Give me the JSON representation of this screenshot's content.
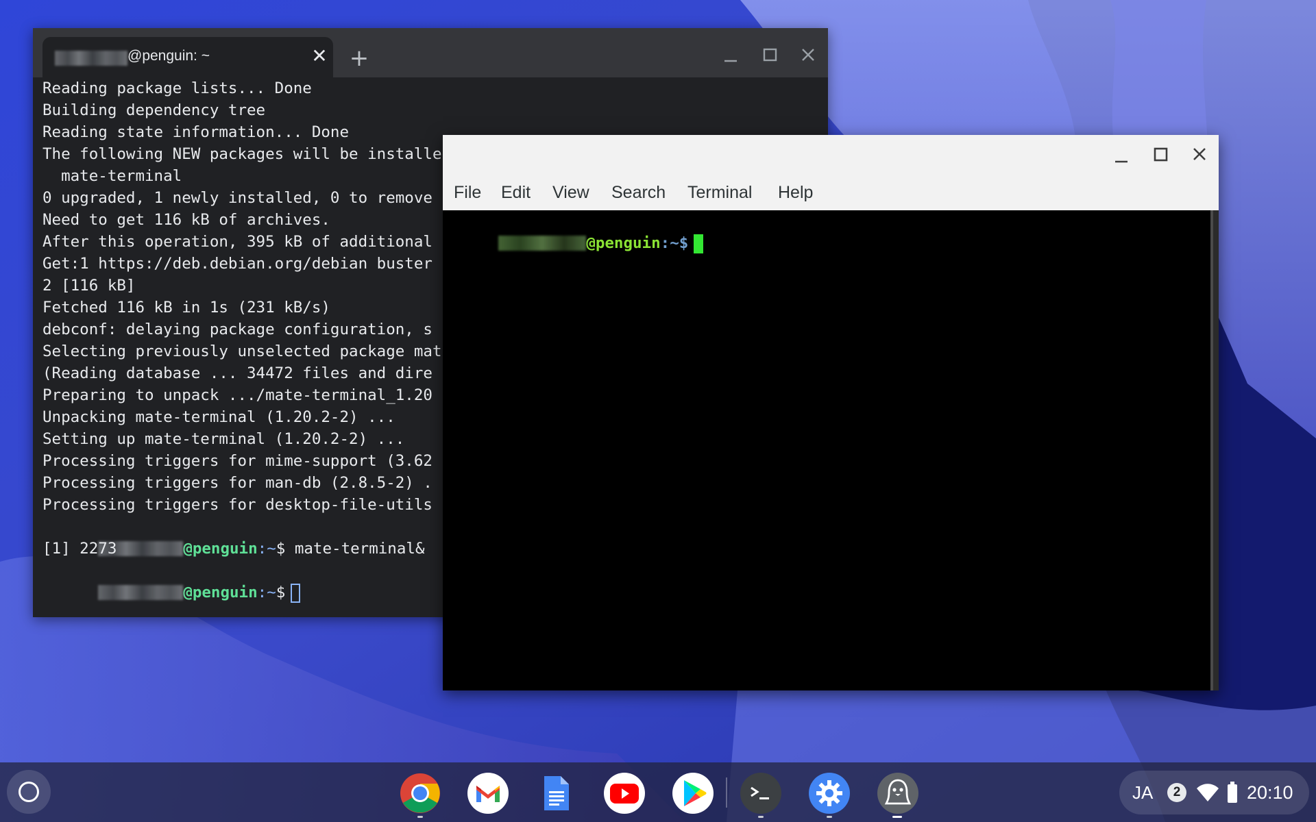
{
  "terminal": {
    "tab_title": "@penguin: ~",
    "lines": [
      "Reading package lists... Done",
      "Building dependency tree",
      "Reading state information... Done",
      "The following NEW packages will be installe",
      "  mate-terminal",
      "0 upgraded, 1 newly installed, 0 to remove",
      "Need to get 116 kB of archives.",
      "After this operation, 395 kB of additional",
      "Get:1 https://deb.debian.org/debian buster",
      "2 [116 kB]",
      "Fetched 116 kB in 1s (231 kB/s)",
      "debconf: delaying package configuration, s",
      "Selecting previously unselected package mat",
      "(Reading database ... 34472 files and dire",
      "Preparing to unpack .../mate-terminal_1.20",
      "Unpacking mate-terminal (1.20.2-2) ...",
      "Setting up mate-terminal (1.20.2-2) ...",
      "Processing triggers for mime-support (3.62",
      "Processing triggers for man-db (2.8.5-2) .",
      "Processing triggers for desktop-file-utils"
    ],
    "prompt_host": "@penguin",
    "prompt_path": ":~",
    "prompt_symbol": "$",
    "command": "mate-terminal&",
    "job_output": "[1] 2273"
  },
  "mate": {
    "menu": [
      "File",
      "Edit",
      "View",
      "Search",
      "Terminal",
      "Help"
    ],
    "prompt_host": "@penguin",
    "prompt_path": ":~",
    "prompt_symbol": "$"
  },
  "shelf": {
    "apps": [
      "chrome-icon",
      "gmail-icon",
      "docs-icon",
      "youtube-icon",
      "play-store-icon",
      "terminal-icon",
      "settings-icon",
      "linux-penguin-icon"
    ],
    "status": {
      "ime": "JA",
      "notification_count": "2",
      "time": "20:10"
    }
  },
  "colors": {
    "terminal_bg": "#202124",
    "prompt_green": "#5fe097",
    "prompt_blue": "#8ab4f8",
    "mate_prompt_green": "#8ae234",
    "mate_cursor": "#33e633"
  }
}
